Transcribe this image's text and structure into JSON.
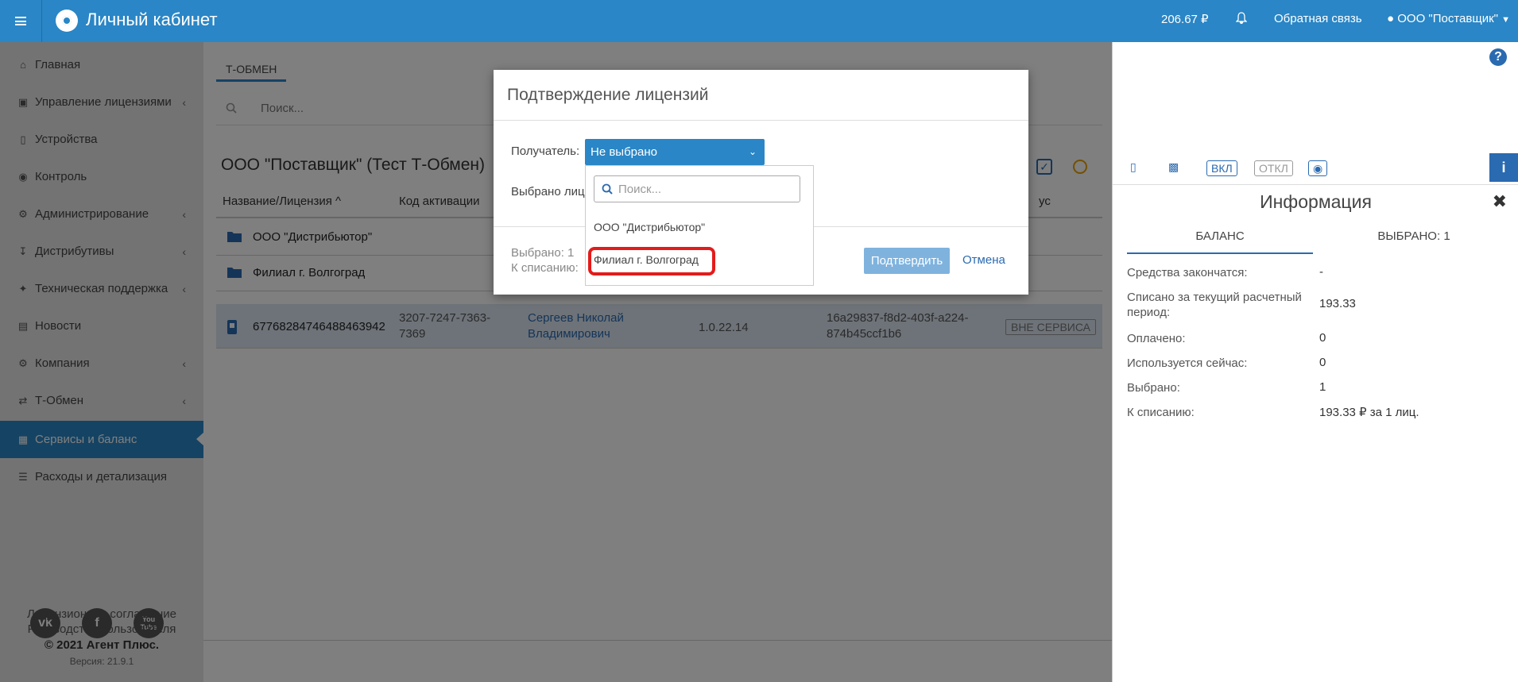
{
  "topbar": {
    "title": "Личный кабинет",
    "balance": "206.67 ₽",
    "feedback": "Обратная связь",
    "user": "ООО \"Поставщик\""
  },
  "sidebar": {
    "items": [
      {
        "label": "Главная",
        "icon": "home-icon"
      },
      {
        "label": "Управление лицензиями",
        "icon": "sitemap-icon"
      },
      {
        "label": "Устройства",
        "icon": "mobile-icon"
      },
      {
        "label": "Контроль",
        "icon": "globe-icon"
      },
      {
        "label": "Администрирование",
        "icon": "gears-icon"
      },
      {
        "label": "Дистрибутивы",
        "icon": "download-icon"
      },
      {
        "label": "Техническая поддержка",
        "icon": "wrench-icon"
      },
      {
        "label": "Новости",
        "icon": "newspaper-icon"
      },
      {
        "label": "Компания",
        "icon": "gear-icon"
      },
      {
        "label": "Т-Обмен",
        "icon": "shuffle-icon"
      },
      {
        "label": "Сервисы и баланс",
        "icon": "money-icon"
      },
      {
        "label": "Расходы и детализация",
        "icon": "list-icon"
      }
    ],
    "social": [
      "vk",
      "f",
      "You Tube"
    ],
    "footer": {
      "license": "Лицензионное соглашение",
      "guide": "Руководство пользователя",
      "copyright": "© 2021 Агент Плюс.",
      "version": "Версия: 21.9.1"
    }
  },
  "main": {
    "tab": "Т-ОБМЕН",
    "search_placeholder": "Поиск...",
    "heading": "ООО \"Поставщик\" (Тест Т-Обмен)",
    "columns": [
      "Название/Лицензия ^",
      "Код активации",
      "ус"
    ],
    "folders": [
      "ООО \"Дистрибьютор\"",
      "Филиал г. Волгоград"
    ],
    "selected_row": {
      "name": "67768284746488463942",
      "code": "3207-7247-7363-7369",
      "person": "Сергеев Николай Владимирович",
      "version": "1.0.22.14",
      "guid": "16a29837-f8d2-403f-a224-874b45ccf1b6",
      "status": "ВНЕ СЕРВИСА"
    }
  },
  "right_panel": {
    "title": "Информация",
    "tools": {
      "on": "ВКЛ",
      "off": "ОТКЛ"
    },
    "tab_balance": "БАЛАНС",
    "tab_selected": "ВЫБРАНО: 1",
    "rows": [
      {
        "label": "Средства закончатся:",
        "value": "-"
      },
      {
        "label": "Списано за текущий расчетный период:",
        "value": "193.33"
      },
      {
        "label": "Оплачено:",
        "value": "0"
      },
      {
        "label": "Используется сейчас:",
        "value": "0"
      },
      {
        "label": "Выбрано:",
        "value": "1"
      },
      {
        "label": "К списанию:",
        "value": "193.33 ₽ за 1 лиц."
      }
    ]
  },
  "modal": {
    "title": "Подтверждение лицензий",
    "recipient_label": "Получатель:",
    "recipient_value": "Не выбрано",
    "selected_label": "Выбрано лиц",
    "summary_selected": "Выбрано: 1",
    "summary_writeoff": "К списанию:",
    "confirm": "Подтвердить",
    "cancel": "Отмена",
    "dropdown": {
      "search_placeholder": "Поиск...",
      "options": [
        "ООО \"Дистрибьютор\"",
        "Филиал г. Волгоград"
      ]
    }
  },
  "colors": {
    "brand": "#2a86c6",
    "highlight": "#e41b1b"
  }
}
